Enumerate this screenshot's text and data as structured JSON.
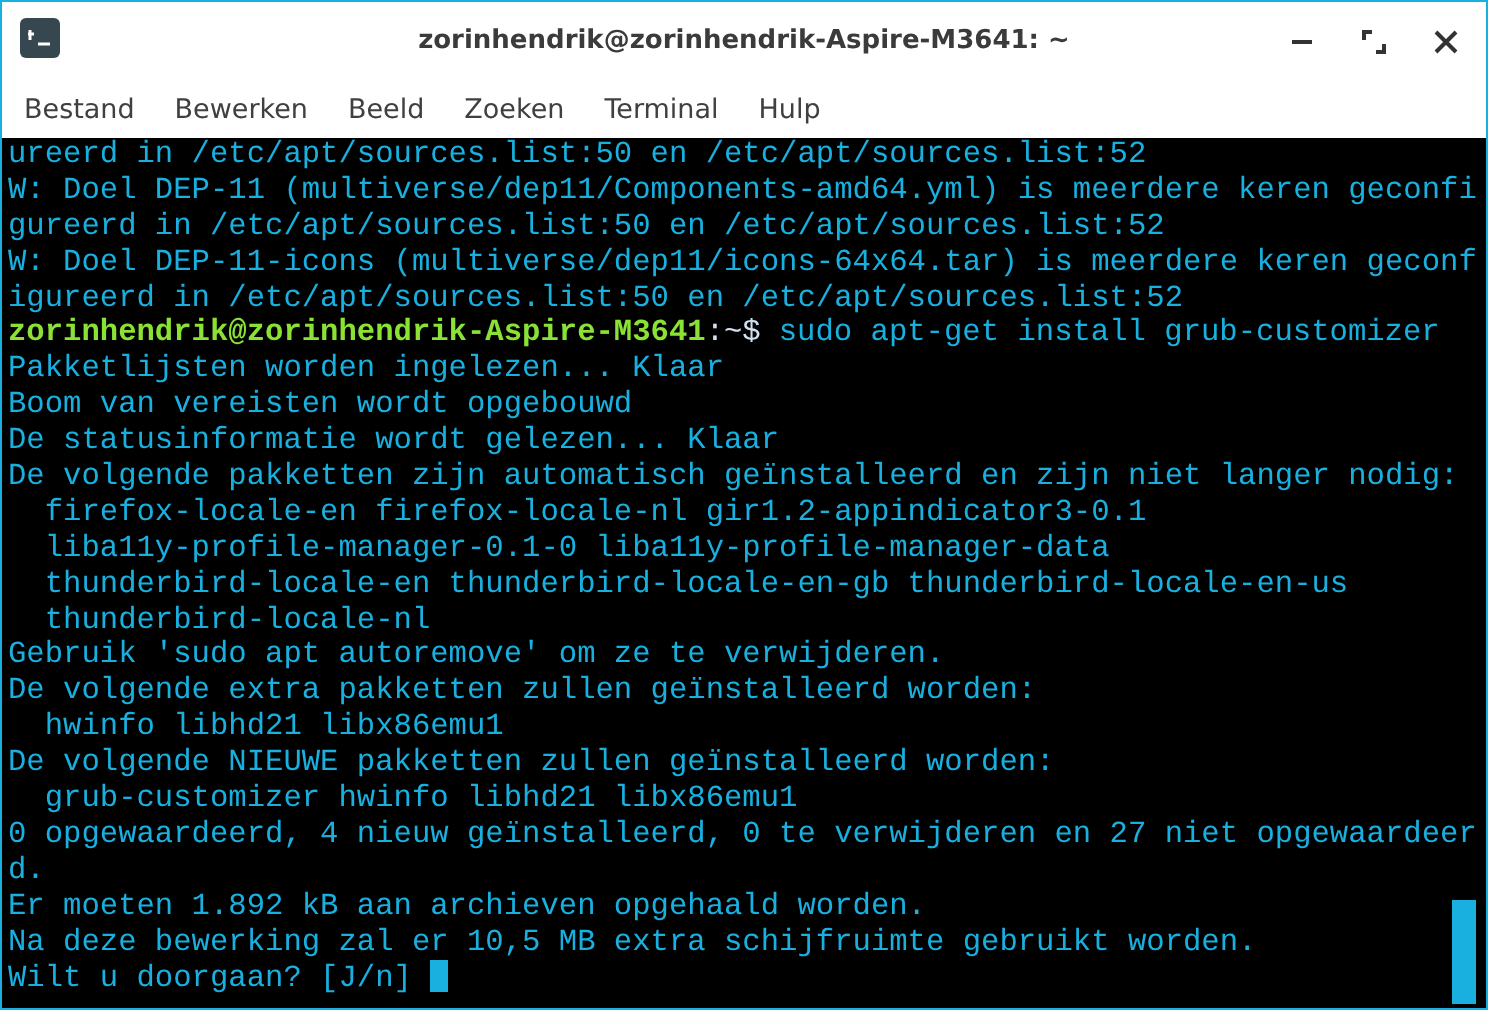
{
  "window": {
    "title": "zorinhendrik@zorinhendrik-Aspire-M3641: ~"
  },
  "menu": [
    "Bestand",
    "Bewerken",
    "Beeld",
    "Zoeken",
    "Terminal",
    "Hulp"
  ],
  "terminal": {
    "lines": [
      {
        "kind": "output",
        "text": "ureerd in /etc/apt/sources.list:50 en /etc/apt/sources.list:52"
      },
      {
        "kind": "output",
        "text": "W: Doel DEP-11 (multiverse/dep11/Components-amd64.yml) is meerdere keren geconfi"
      },
      {
        "kind": "output",
        "text": "gureerd in /etc/apt/sources.list:50 en /etc/apt/sources.list:52"
      },
      {
        "kind": "output",
        "text": "W: Doel DEP-11-icons (multiverse/dep11/icons-64x64.tar) is meerdere keren geconf"
      },
      {
        "kind": "output",
        "text": "igureerd in /etc/apt/sources.list:50 en /etc/apt/sources.list:52"
      },
      {
        "kind": "prompt",
        "user": "zorinhendrik@zorinhendrik-Aspire-M3641",
        "path": ":~$",
        "text": "sudo apt-get install grub-customizer"
      },
      {
        "kind": "output",
        "text": "Pakketlijsten worden ingelezen... Klaar"
      },
      {
        "kind": "output",
        "text": "Boom van vereisten wordt opgebouwd"
      },
      {
        "kind": "output",
        "text": "De statusinformatie wordt gelezen... Klaar"
      },
      {
        "kind": "output",
        "text": "De volgende pakketten zijn automatisch geïnstalleerd en zijn niet langer nodig:"
      },
      {
        "kind": "output",
        "text": "  firefox-locale-en firefox-locale-nl gir1.2-appindicator3-0.1"
      },
      {
        "kind": "output",
        "text": "  liba11y-profile-manager-0.1-0 liba11y-profile-manager-data"
      },
      {
        "kind": "output",
        "text": "  thunderbird-locale-en thunderbird-locale-en-gb thunderbird-locale-en-us"
      },
      {
        "kind": "output",
        "text": "  thunderbird-locale-nl"
      },
      {
        "kind": "output",
        "text": "Gebruik 'sudo apt autoremove' om ze te verwijderen."
      },
      {
        "kind": "output",
        "text": "De volgende extra pakketten zullen geïnstalleerd worden:"
      },
      {
        "kind": "output",
        "text": "  hwinfo libhd21 libx86emu1"
      },
      {
        "kind": "output",
        "text": "De volgende NIEUWE pakketten zullen geïnstalleerd worden:"
      },
      {
        "kind": "output",
        "text": "  grub-customizer hwinfo libhd21 libx86emu1"
      },
      {
        "kind": "output",
        "text": "0 opgewaardeerd, 4 nieuw geïnstalleerd, 0 te verwijderen en 27 niet opgewaardeer"
      },
      {
        "kind": "output",
        "text": "d."
      },
      {
        "kind": "output",
        "text": "Er moeten 1.892 kB aan archieven opgehaald worden."
      },
      {
        "kind": "output",
        "text": "Na deze bewerking zal er 10,5 MB extra schijfruimte gebruikt worden."
      },
      {
        "kind": "input",
        "text": "Wilt u doorgaan? [J/n]"
      }
    ]
  }
}
